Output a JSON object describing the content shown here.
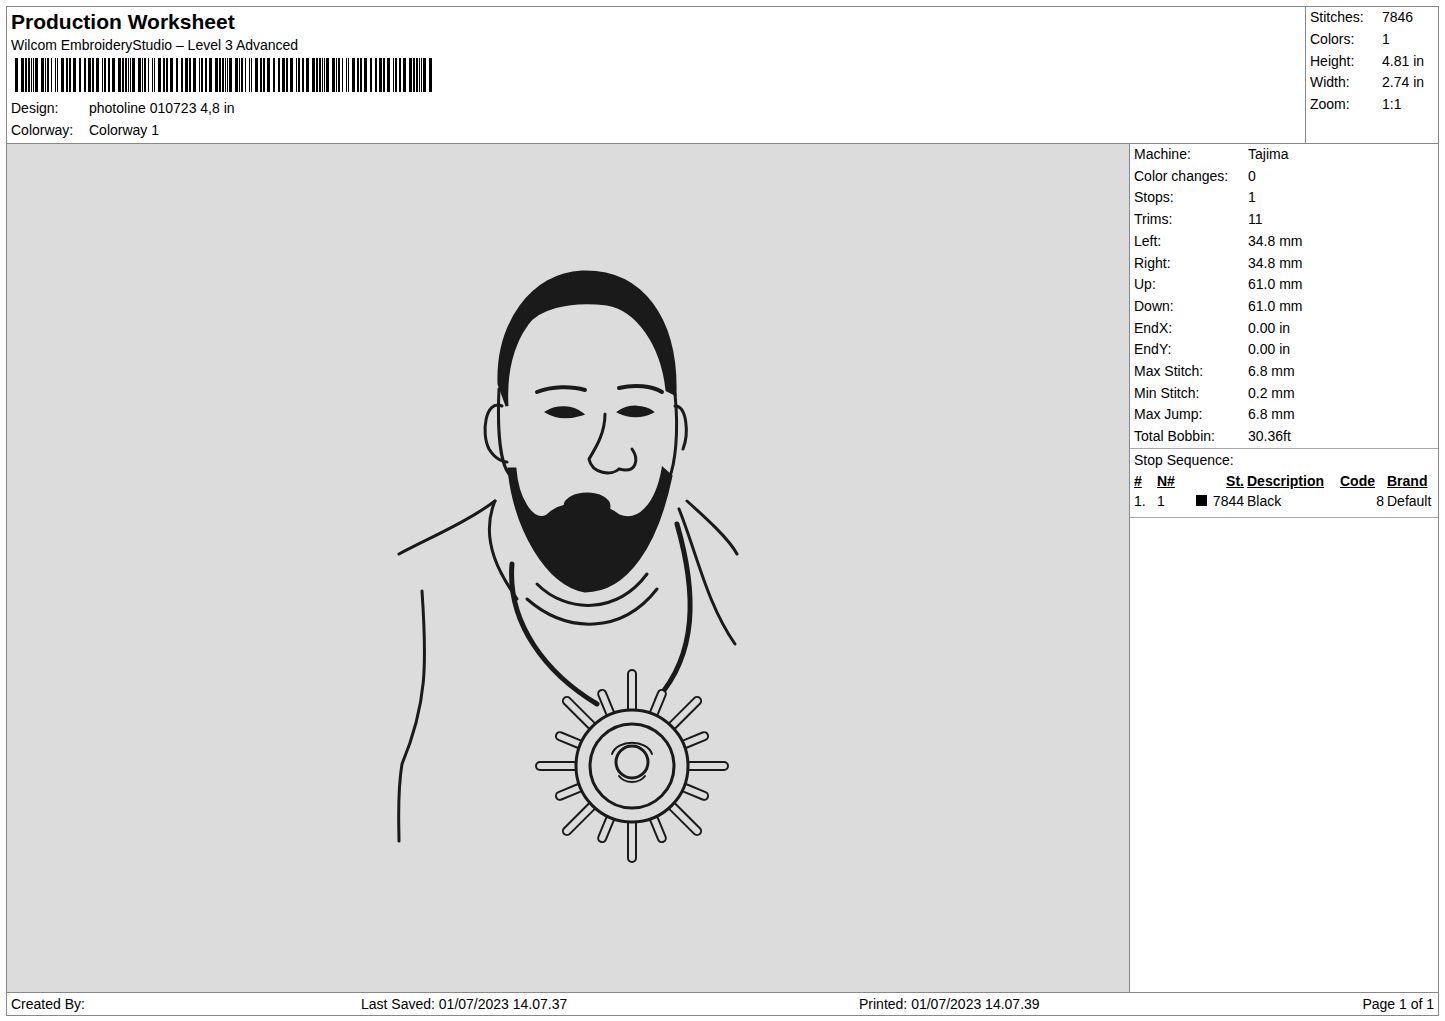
{
  "header": {
    "title": "Production Worksheet",
    "software": "Wilcom EmbroideryStudio – Level 3 Advanced",
    "fields": [
      {
        "label": "Design:",
        "value": "photoline 010723 4,8 in"
      },
      {
        "label": "Colorway:",
        "value": "Colorway 1"
      }
    ]
  },
  "summary": [
    {
      "label": "Stitches:",
      "value": "7846"
    },
    {
      "label": "Colors:",
      "value": "1"
    },
    {
      "label": "Height:",
      "value": "4.81 in"
    },
    {
      "label": "Width:",
      "value": "2.74 in"
    },
    {
      "label": "Zoom:",
      "value": "1:1"
    }
  ],
  "properties": [
    {
      "label": "Machine:",
      "value": "Tajima"
    },
    {
      "label": "Color changes:",
      "value": "0"
    },
    {
      "label": "Stops:",
      "value": "1"
    },
    {
      "label": "Trims:",
      "value": "11"
    },
    {
      "label": "Left:",
      "value": "34.8 mm"
    },
    {
      "label": "Right:",
      "value": "34.8 mm"
    },
    {
      "label": "Up:",
      "value": "61.0 mm"
    },
    {
      "label": "Down:",
      "value": "61.0 mm"
    },
    {
      "label": "EndX:",
      "value": "0.00 in"
    },
    {
      "label": "EndY:",
      "value": "0.00 in"
    },
    {
      "label": "Max Stitch:",
      "value": "6.8 mm"
    },
    {
      "label": "Min Stitch:",
      "value": "0.2 mm"
    },
    {
      "label": "Max Jump:",
      "value": "6.8 mm"
    },
    {
      "label": "Total Bobbin:",
      "value": "30.36ft"
    }
  ],
  "stop_sequence": {
    "title": "Stop Sequence:",
    "columns": [
      "#",
      "N#",
      "St.",
      "Description",
      "Code",
      "Brand"
    ],
    "rows": [
      {
        "num": "1.",
        "n": "1",
        "color": "#000000",
        "stitches": "7844",
        "description": "Black",
        "code": "8",
        "brand": "Default"
      }
    ]
  },
  "footer": {
    "created_by": "Created By:",
    "last_saved": "Last Saved: 01/07/2023 14.07.37",
    "printed": "Printed: 01/07/2023 14.07.39",
    "page": "Page 1 of 1"
  }
}
